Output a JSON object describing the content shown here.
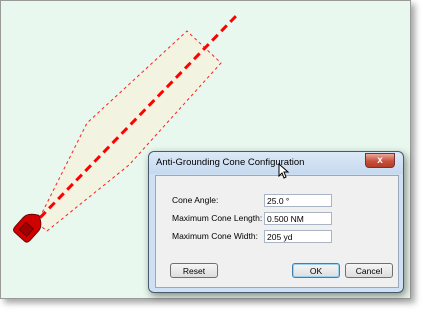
{
  "colors": {
    "background": "#e8f8ee",
    "cone_fill": "#f2f3e0",
    "cone_outline": "#ff2020",
    "heading_line": "#ff0000",
    "vessel": "#d00000"
  },
  "map": {
    "vessel_icon": "boat-icon"
  },
  "dialog": {
    "title": "Anti-Grounding Cone Configuration",
    "close_label": "x",
    "fields": [
      {
        "label": "Cone Angle:",
        "value": "25.0 °"
      },
      {
        "label": "Maximum Cone Length:",
        "value": "0.500 NM"
      },
      {
        "label": "Maximum Cone Width:",
        "value": "205 yd"
      }
    ],
    "buttons": {
      "reset": "Reset",
      "ok": "OK",
      "cancel": "Cancel"
    }
  }
}
